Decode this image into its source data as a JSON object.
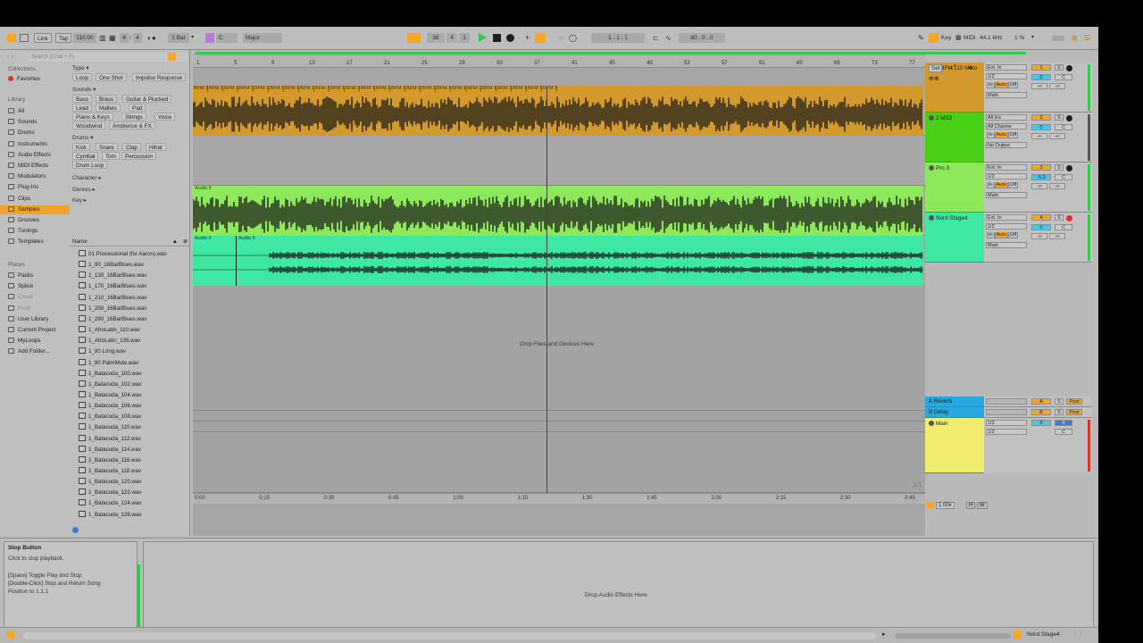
{
  "transport": {
    "link": "Link",
    "tap": "Tap",
    "tempo": "110.00",
    "signature_num": "4",
    "signature_den": "4",
    "quant": "1 Bar",
    "key": "C",
    "scale": "Major",
    "pos_bar": "38",
    "pos_beat": "4",
    "pos_sixteenth": "1",
    "loop_start": "1 .",
    "loop_start_b": "1 .",
    "loop_start_c": "1",
    "loop_len_a": "80 .",
    "loop_len_b": "0 .",
    "loop_len_c": "0",
    "key_label": "Key",
    "midi_label": "MIDI",
    "sample_rate": "44.1 kHz",
    "cpu": "1 %"
  },
  "browser": {
    "search_placeholder": "Search (Cmd + F)",
    "collections_label": "Collections",
    "favorites": "Favorites",
    "library_label": "Library",
    "library_items": [
      "All",
      "Sounds",
      "Drums",
      "Instruments",
      "Audio Effects",
      "MIDI Effects",
      "Modulators",
      "Plug-Ins",
      "Clips",
      "Samples",
      "Grooves",
      "Tunings",
      "Templates"
    ],
    "places_label": "Places",
    "places_items": [
      "Packs",
      "Splice",
      "Cloud",
      "Push",
      "User Library",
      "Current Project",
      "MyLoops",
      "Add Folder..."
    ],
    "type_label": "Type",
    "type_chips": [
      "Loop",
      "One Shot",
      "Impulse Response"
    ],
    "sounds_label": "Sounds",
    "sounds_chips": [
      "Bass",
      "Brass",
      "Guitar & Plucked",
      "Lead",
      "Mallets",
      "Pad",
      "Piano & Keys",
      "Strings",
      "Voice",
      "Woodwind",
      "Ambience & FX"
    ],
    "drums_label": "Drums",
    "drums_chips": [
      "Kick",
      "Snare",
      "Clap",
      "Hihat",
      "Cymbal",
      "Tom",
      "Percussion",
      "Drum Loop"
    ],
    "character_label": "Character",
    "genres_label": "Genres",
    "key_label": "Key",
    "name_header": "Name",
    "files": [
      "01 Processional (for Aaron).wav",
      "1_90_16BarBlues.wav",
      "1_130_16BarBlues.wav",
      "1_170_16BarBlues.wav",
      "1_210_16BarBlues.wav",
      "1_250_16BarBlues.wav",
      "1_290_16BarBlues.wav",
      "1_AfroLatin_110.wav",
      "1_AfroLatin_135.wav",
      "1_80 Long.wav",
      "1_80 PalmMute.wav",
      "1_Batacuda_100.wav",
      "1_Batacuda_102.wav",
      "1_Batacuda_104.wav",
      "1_Batacuda_106.wav",
      "1_Batacuda_108.wav",
      "1_Batacuda_110.wav",
      "1_Batacuda_112.wav",
      "1_Batacuda_114.wav",
      "1_Batacuda_116.wav",
      "1_Batacuda_118.wav",
      "1_Batacuda_120.wav",
      "1_Batacuda_122.wav",
      "1_Batacuda_124.wav",
      "1_Batacuda_126.wav"
    ]
  },
  "ruler": {
    "bars": [
      "1",
      "5",
      "9",
      "13",
      "17",
      "21",
      "25",
      "29",
      "33",
      "37",
      "41",
      "45",
      "49",
      "53",
      "57",
      "61",
      "65",
      "69",
      "73",
      "77"
    ],
    "times": [
      "0:00",
      "0:15",
      "0:30",
      "0:45",
      "1:00",
      "1:15",
      "1:30",
      "1:45",
      "2:00",
      "2:15",
      "2:30",
      "2:45"
    ]
  },
  "clips": {
    "bfm_label": "BFM 1",
    "audio6_a": "Audio 6",
    "audio6_b": "Audio 6",
    "audio5": "Audio 5"
  },
  "drop_files": "Drop Files and Devices Here",
  "page_indicator": "1/1",
  "tracks": [
    {
      "name": "1 BFM 110 Moto",
      "color": "#d39a2b",
      "input": "Ext. In",
      "channel": "1/2",
      "output": "Main",
      "num": "1"
    },
    {
      "name": "2 MIDI",
      "color": "#49d016",
      "input": "All Ins",
      "channel": "All Channe",
      "output": "No Output",
      "num": "2"
    },
    {
      "name": "Pro 3",
      "color": "#8de85a",
      "input": "Ext. In",
      "channel": "1/2",
      "output": "Main",
      "num": "3"
    },
    {
      "name": "Nord Stage4",
      "color": "#3ee8a3",
      "input": "Ext. In",
      "channel": "1/2",
      "output": "Main",
      "num": "4"
    }
  ],
  "returns": [
    {
      "name": "A Reverb",
      "color": "#29a8e0",
      "letter": "A"
    },
    {
      "name": "B Delay",
      "color": "#29a8e0",
      "letter": "B"
    }
  ],
  "main_track": {
    "name": "Main",
    "color": "#f0ed6e",
    "out_a": "1/2",
    "out_b": "1/2",
    "vol": "0",
    "pan": "C"
  },
  "mix_labels": {
    "in": "In",
    "auto": "Auto",
    "off": "Off",
    "s": "S",
    "post": "Post",
    "c": "C",
    "inf": "-∞",
    "zero": "0",
    "minus5": "-5.0",
    "vol_main": "0"
  },
  "info": {
    "title": "Stop Button",
    "desc": "Click to stop playback.",
    "line1": "[Space] Toggle Play and Stop",
    "line2": "[Double-Click] Stop and Return Song",
    "line3": "Position to 1.1.1"
  },
  "device_drop": "Drop Audio Effects Here",
  "status_track": "Nord Stage4",
  "zoom": "1.00x",
  "h_label": "H",
  "w_label": "W"
}
